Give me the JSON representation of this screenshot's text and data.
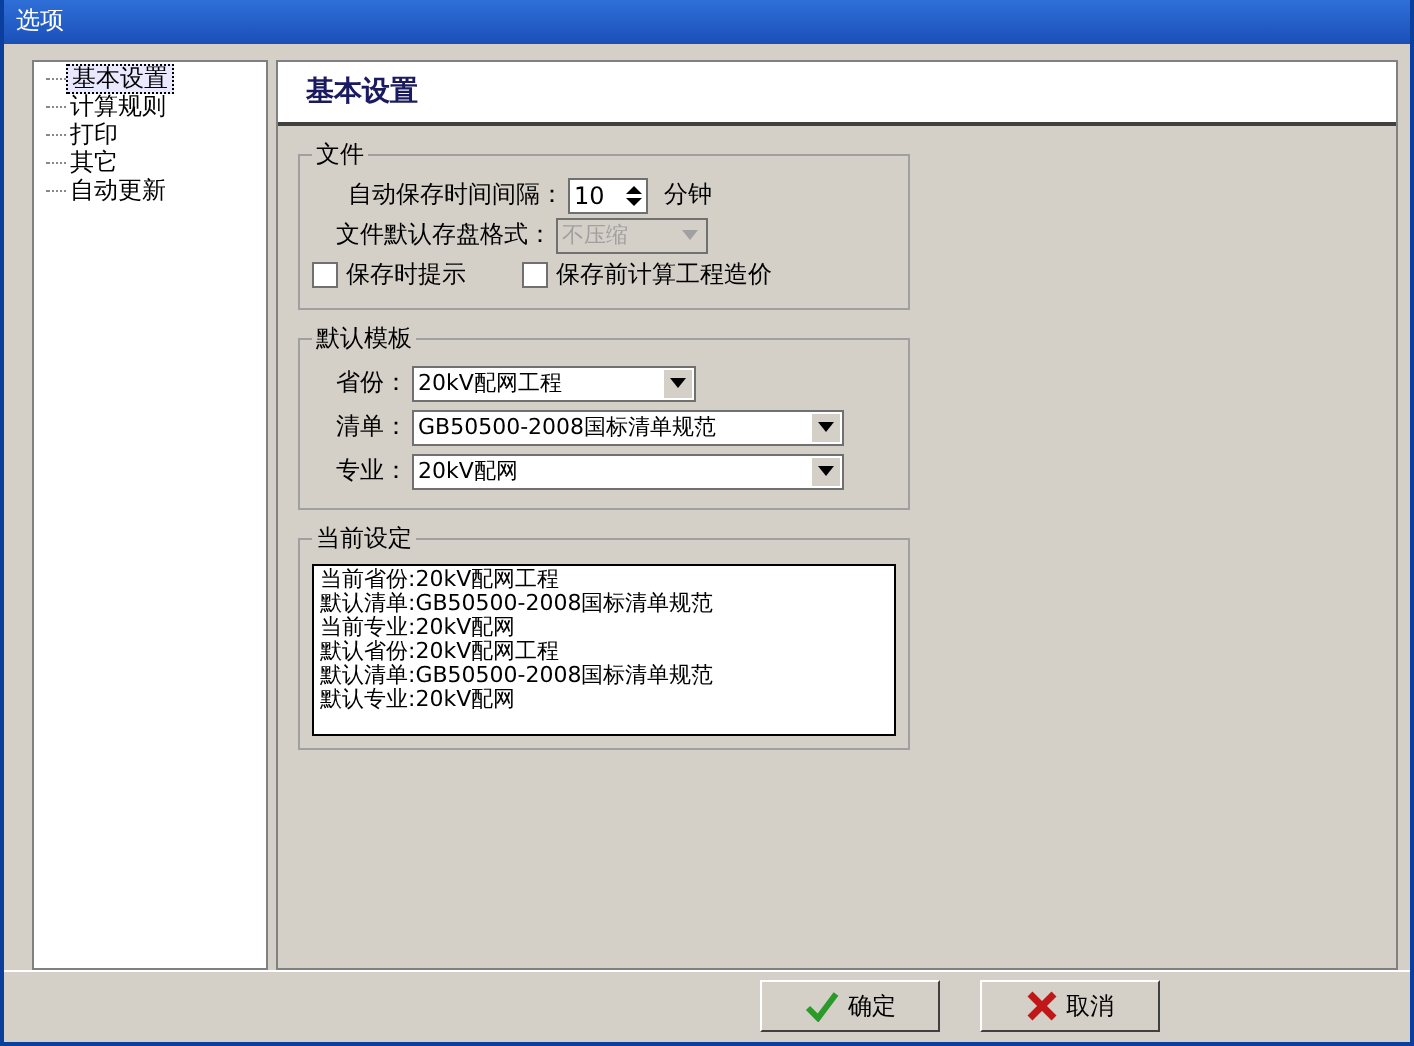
{
  "window": {
    "title": "选项"
  },
  "nav": [
    {
      "label": "基本设置",
      "selected": true
    },
    {
      "label": "计算规则",
      "selected": false
    },
    {
      "label": "打印",
      "selected": false
    },
    {
      "label": "其它",
      "selected": false
    },
    {
      "label": "自动更新",
      "selected": false
    }
  ],
  "page_title": "基本设置",
  "file_group": {
    "title": "文件",
    "interval": {
      "label": "自动保存时间间隔：",
      "value": "10",
      "unit": "分钟"
    },
    "format": {
      "label": "文件默认存盘格式：",
      "value": "不压缩",
      "disabled": true
    },
    "checkboxes": [
      {
        "label": "保存时提示",
        "checked": false
      },
      {
        "label": "保存前计算工程造价",
        "checked": false
      }
    ]
  },
  "template_group": {
    "title": "默认模板",
    "selects": [
      {
        "label": "省份：",
        "value": "20kV配网工程",
        "wide": false
      },
      {
        "label": "清单：",
        "value": "GB50500-2008国标清单规范",
        "wide": true
      },
      {
        "label": "专业：",
        "value": "20kV配网",
        "wide": true
      }
    ]
  },
  "current_group": {
    "title": "当前设定",
    "lines": [
      "当前省份:20kV配网工程",
      "默认清单:GB50500-2008国标清单规范",
      "当前专业:20kV配网",
      "默认省份:20kV配网工程",
      "默认清单:GB50500-2008国标清单规范",
      "默认专业:20kV配网"
    ]
  },
  "buttons": [
    {
      "label": "确定",
      "kind": "ok"
    },
    {
      "label": "取消",
      "kind": "cancel"
    }
  ]
}
